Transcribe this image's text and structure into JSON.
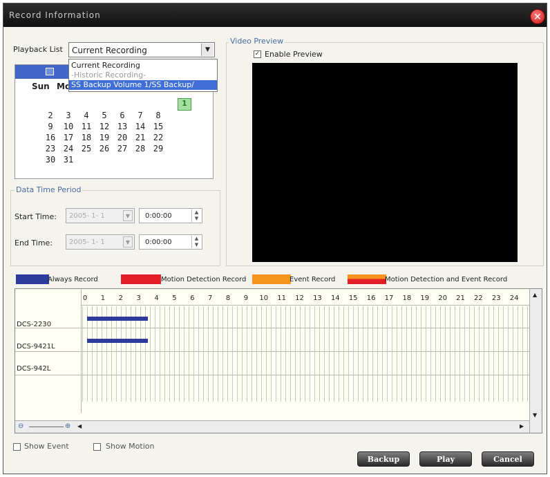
{
  "window": {
    "title": "Record Information",
    "close": "✕"
  },
  "playback": {
    "label": "Playback List",
    "selected": "Current Recording",
    "arrow": "▼",
    "options": [
      "Current Recording",
      "-Historic Recording-",
      "SS  Backup Volume  1/SS Backup/"
    ]
  },
  "calendar": {
    "weekday_visible": "Sun",
    "partial_header": "Mo",
    "today": "1",
    "days_row1": [
      "2",
      "3",
      "4",
      "5",
      "6",
      "7",
      "8"
    ],
    "days_row2": [
      "9",
      "10",
      "11",
      "12",
      "13",
      "14",
      "15"
    ],
    "days_row3": [
      "16",
      "17",
      "18",
      "19",
      "20",
      "21",
      "22"
    ],
    "days_row4": [
      "23",
      "24",
      "25",
      "26",
      "27",
      "28",
      "29"
    ],
    "days_row5": [
      "30",
      "31"
    ]
  },
  "period": {
    "title": "Data Time Period",
    "start_label": "Start Time:",
    "end_label": "End Time:",
    "start_date": "2005- 1- 1",
    "end_date": "2005- 1- 1",
    "start_time": "0:00:00",
    "end_time": "0:00:00"
  },
  "preview": {
    "title": "Video Preview",
    "enable_label": "Enable Preview",
    "enable_checked": true
  },
  "legend": [
    {
      "label": "Always Record",
      "color": "#2d3c9c"
    },
    {
      "label": "Motion Detection Record",
      "color": "#e21f26"
    },
    {
      "label": "Event Record",
      "color": "#f7941d"
    },
    {
      "label": "Motion Detection and Event Record",
      "color": "#e21f26"
    }
  ],
  "timeline": {
    "hours": [
      "0",
      "1",
      "2",
      "3",
      "4",
      "5",
      "6",
      "7",
      "8",
      "9",
      "10",
      "11",
      "12",
      "13",
      "14",
      "15",
      "16",
      "17",
      "18",
      "19",
      "20",
      "21",
      "22",
      "23",
      "24"
    ],
    "cameras": [
      "DCS-2230",
      "DCS-9421L",
      "DCS-942L"
    ],
    "recordings": [
      {
        "camera": "DCS-2230",
        "start_hour": 0.1,
        "end_hour": 3.5
      },
      {
        "camera": "DCS-9421L",
        "start_hour": 0.1,
        "end_hour": 3.5
      }
    ]
  },
  "options": {
    "show_event": "Show Event",
    "show_motion": "Show Motion"
  },
  "buttons": {
    "backup": "Backup",
    "play": "Play",
    "cancel": "Cancel"
  }
}
